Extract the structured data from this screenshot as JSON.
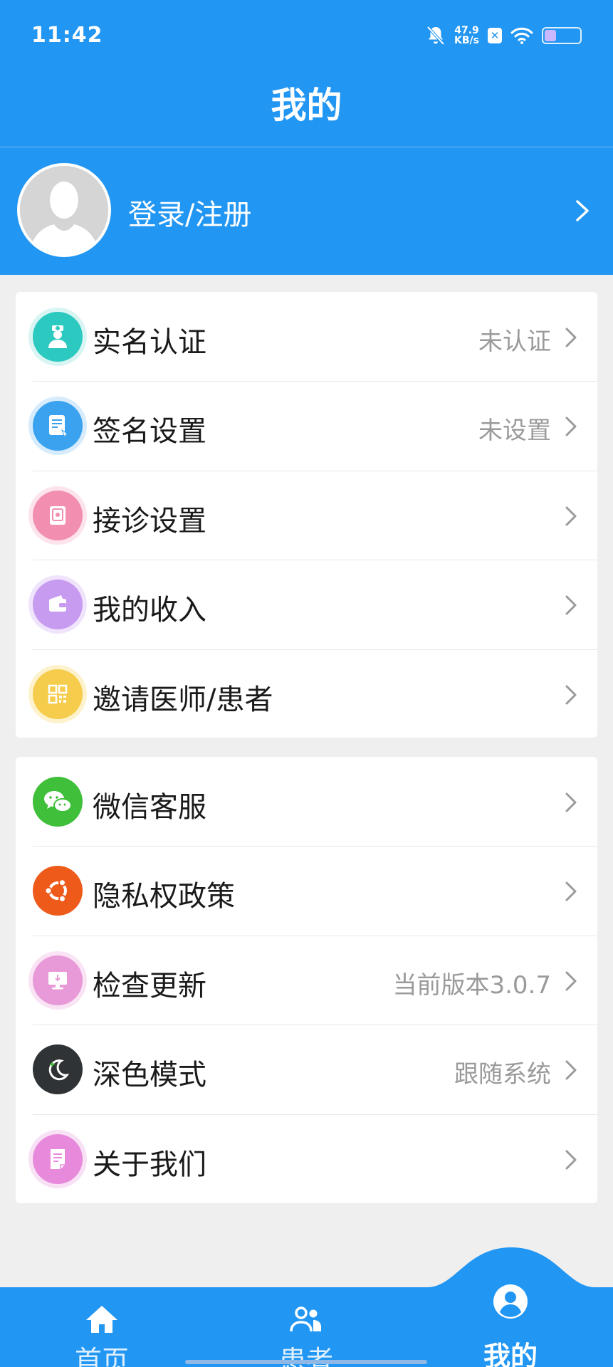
{
  "status_bar": {
    "time": "11:42",
    "speed_value": "47.9",
    "speed_unit": "KB/s",
    "icons": [
      "bell-mute-icon",
      "x-app-icon",
      "wifi-icon",
      "battery-icon"
    ],
    "battery_level": 0.3
  },
  "header": {
    "title": "我的",
    "login_label": "登录/注册"
  },
  "colors": {
    "primary": "#2196F3",
    "background": "#efefef",
    "card": "#ffffff",
    "muted_text": "#9a9a9a"
  },
  "section1": {
    "items": [
      {
        "label": "实名认证",
        "value": "未认证",
        "icon": "doctor-icon",
        "color": "#2cc9c0"
      },
      {
        "label": "签名设置",
        "value": "未设置",
        "icon": "tablet-sign-icon",
        "color": "#3aa2ee"
      },
      {
        "label": "接诊设置",
        "value": "",
        "icon": "safe-icon",
        "color": "#f28fb0"
      },
      {
        "label": "我的收入",
        "value": "",
        "icon": "wallet-icon",
        "color": "#c79bf0"
      },
      {
        "label": "邀请医师/患者",
        "value": "",
        "icon": "qr-code-icon",
        "color": "#f5cc4b"
      }
    ]
  },
  "section2": {
    "items": [
      {
        "label": "微信客服",
        "value": "",
        "icon": "wechat-icon",
        "color": "#3fbf3a"
      },
      {
        "label": "隐私权政策",
        "value": "",
        "icon": "ubuntu-icon",
        "color": "#ee5a1a"
      },
      {
        "label": "检查更新",
        "value": "当前版本3.0.7",
        "icon": "monitor-update-icon",
        "color": "#e89ad8"
      },
      {
        "label": "深色模式",
        "value": "跟随系统",
        "icon": "moon-icon",
        "color": "#2f3335"
      },
      {
        "label": "关于我们",
        "value": "",
        "icon": "document-icon",
        "color": "#e88adc"
      }
    ]
  },
  "bottom_nav": {
    "items": [
      {
        "label": "首页",
        "icon": "home-icon",
        "active": false
      },
      {
        "label": "患者",
        "icon": "patients-icon",
        "active": false
      },
      {
        "label": "我的",
        "icon": "user-circle-icon",
        "active": true
      }
    ]
  }
}
